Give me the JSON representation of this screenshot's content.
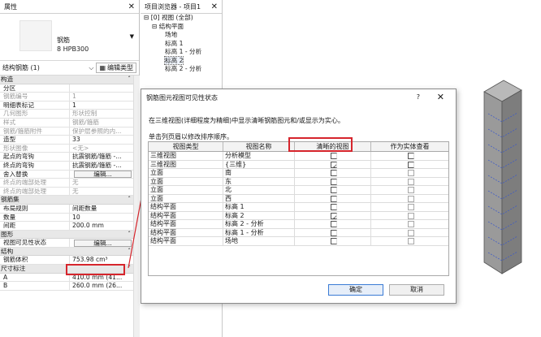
{
  "properties": {
    "title": "属性",
    "type_name_line1": "钢筋",
    "type_name_line2": "8 HPB300",
    "selector": "结构钢筋 (1)",
    "edit_type_label": "编辑类型",
    "section_construct": "构造",
    "rows_construct": [
      {
        "k": "分区",
        "v": "",
        "grey": false
      },
      {
        "k": "钢筋编号",
        "v": "1",
        "grey": true
      },
      {
        "k": "明细表标记",
        "v": "1",
        "grey": false
      },
      {
        "k": "几何图形",
        "v": "形状控制",
        "grey": true
      },
      {
        "k": "样式",
        "v": "钢筋/箍筋",
        "grey": true
      },
      {
        "k": "钢筋/箍筋附件",
        "v": "保护层参照的内...",
        "grey": true
      },
      {
        "k": "造型",
        "v": "33",
        "grey": false
      },
      {
        "k": "形状图像",
        "v": "<无>",
        "grey": true
      },
      {
        "k": "起点的弯钩",
        "v": "抗震钢筋/箍筋 -...",
        "grey": false
      },
      {
        "k": "终点的弯钩",
        "v": "抗震钢筋/箍筋 -...",
        "grey": false
      }
    ],
    "override_label": "舍入替换",
    "edit_button": "编辑...",
    "rows_construct2": [
      {
        "k": "终点的端部处理",
        "v": "无",
        "grey": true
      },
      {
        "k": "终点的端部处理",
        "v": "无",
        "grey": true
      }
    ],
    "section_set": "钢筋集",
    "rows_set": [
      {
        "k": "布局规则",
        "v": "间距数量"
      },
      {
        "k": "数量",
        "v": "10"
      },
      {
        "k": "间距",
        "v": "200.0 mm"
      }
    ],
    "section_graphics": "图形",
    "vis_label": "视图可见性状态",
    "section_struct": "结构",
    "rows_struct": [
      {
        "k": "钢筋体积",
        "v": "753.98 cm³"
      }
    ],
    "section_dims": "尺寸标注",
    "rows_dims": [
      {
        "k": "A",
        "v": "410.0 mm (41..."
      },
      {
        "k": "B",
        "v": "260.0 mm (26..."
      }
    ]
  },
  "browser": {
    "title": "项目浏览器 - 项目1",
    "items": [
      {
        "label": "[0] 视图 (全部)",
        "indent": 0
      },
      {
        "label": "结构平面",
        "indent": 1
      },
      {
        "label": "场地",
        "indent": 2
      },
      {
        "label": "标高 1",
        "indent": 2
      },
      {
        "label": "标高 1 - 分析",
        "indent": 2
      },
      {
        "label": "标高 2",
        "indent": 2
      },
      {
        "label": "标高 2 - 分析",
        "indent": 2
      }
    ]
  },
  "dialog": {
    "title": "钢筋图元视图可见性状态",
    "help": "?",
    "description": "在三维视图(详细程度为精细)中显示清晰钢筋图元和/或显示为实心。",
    "hint": "单击列页眉以修改排序顺序。",
    "columns": [
      "视图类型",
      "视图名称",
      "清晰的视图",
      "作为实体查看"
    ],
    "rows": [
      {
        "type": "三维视图",
        "name": "分析模型",
        "clear": false,
        "solid": false,
        "solid_enabled": true
      },
      {
        "type": "三维视图",
        "name": "{三维}",
        "clear": true,
        "solid": false,
        "solid_enabled": true
      },
      {
        "type": "立面",
        "name": "南",
        "clear": false,
        "solid": false,
        "solid_enabled": false
      },
      {
        "type": "立面",
        "name": "东",
        "clear": false,
        "solid": false,
        "solid_enabled": false
      },
      {
        "type": "立面",
        "name": "北",
        "clear": false,
        "solid": false,
        "solid_enabled": false
      },
      {
        "type": "立面",
        "name": "西",
        "clear": false,
        "solid": false,
        "solid_enabled": false
      },
      {
        "type": "结构平面",
        "name": "标高 1",
        "clear": false,
        "solid": false,
        "solid_enabled": false
      },
      {
        "type": "结构平面",
        "name": "标高 2",
        "clear": true,
        "solid": false,
        "solid_enabled": false
      },
      {
        "type": "结构平面",
        "name": "标高 2 - 分析",
        "clear": false,
        "solid": false,
        "solid_enabled": false
      },
      {
        "type": "结构平面",
        "name": "标高 1 - 分析",
        "clear": false,
        "solid": false,
        "solid_enabled": false
      },
      {
        "type": "结构平面",
        "name": "场地",
        "clear": false,
        "solid": false,
        "solid_enabled": false
      }
    ],
    "ok": "确定",
    "cancel": "取消"
  },
  "colors": {
    "highlight_red": "#d6252c",
    "accent": "#3a7bd5"
  }
}
